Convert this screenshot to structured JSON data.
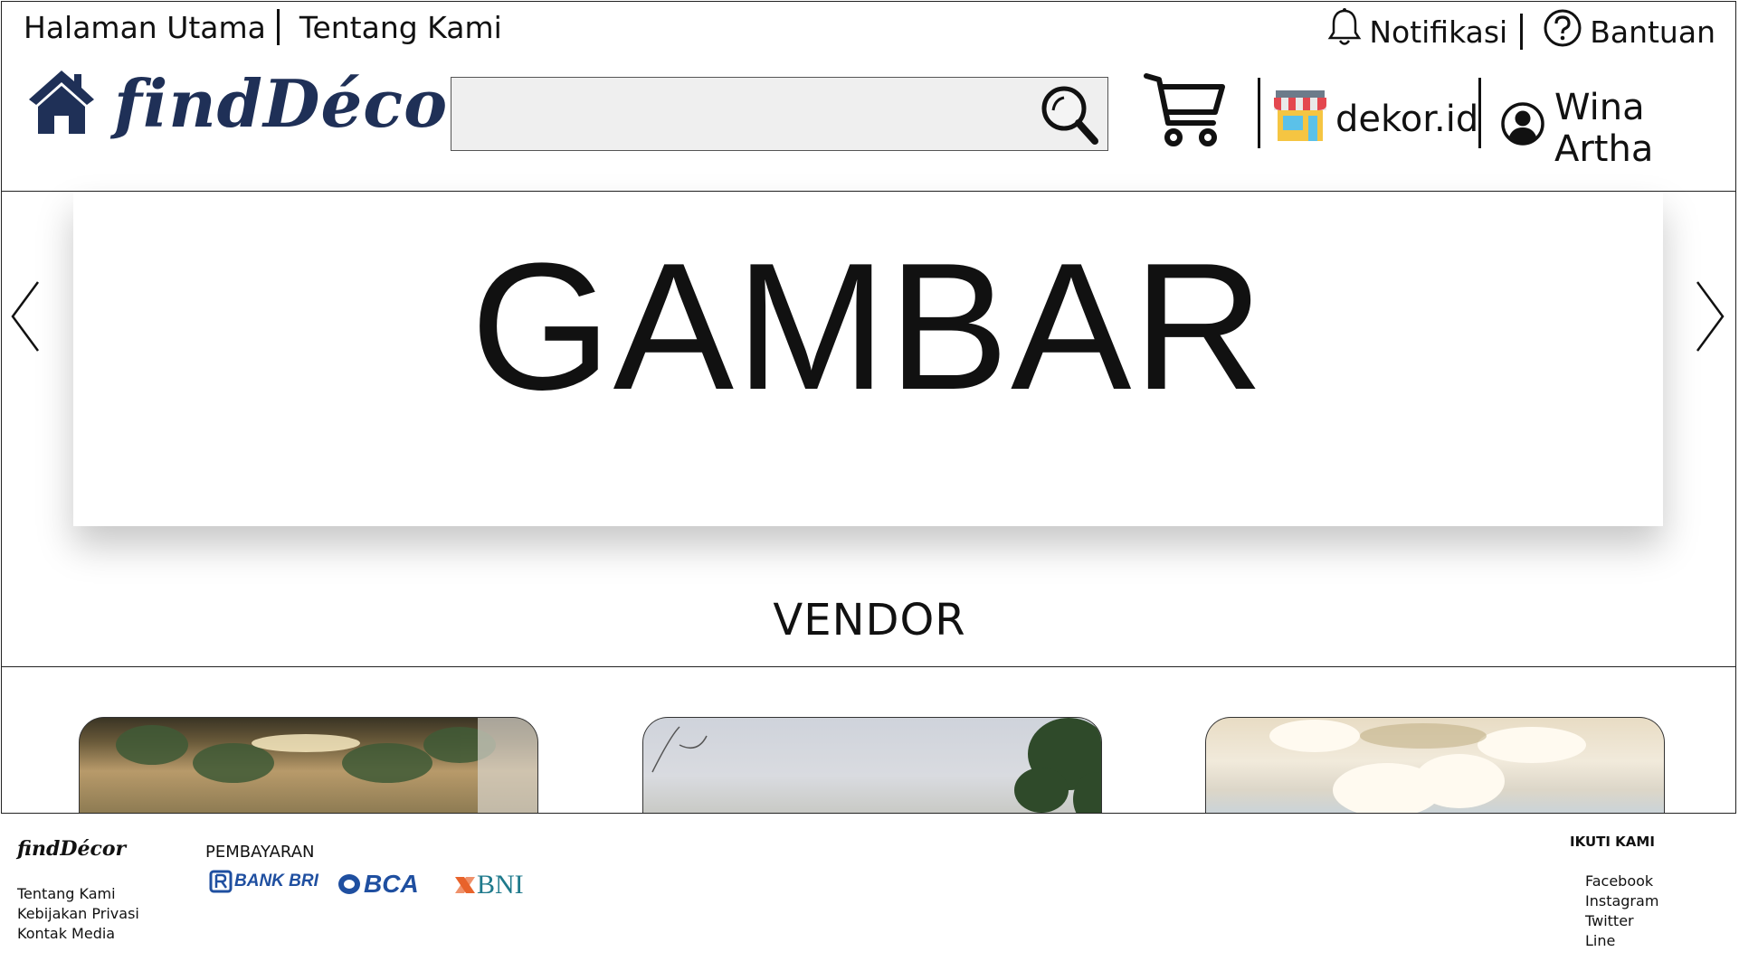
{
  "top_nav": {
    "home": "Halaman Utama",
    "about": "Tentang Kami",
    "notifications": "Notifikasi",
    "help": "Bantuan"
  },
  "header": {
    "logo_text": "findDécor",
    "search_placeholder": "",
    "store_name": "dekor.id",
    "user_name": "Wina Artha",
    "brand_color": "#1f3057"
  },
  "banner": {
    "text": "GAMBAR"
  },
  "section": {
    "title": "VENDOR"
  },
  "vendor_cards": [
    {
      "image": "wedding-backdrop-photo"
    },
    {
      "image": "outdoor-sky-photo"
    },
    {
      "image": "floral-decoration-photo"
    }
  ],
  "footer": {
    "logo_text": "findDécor",
    "links": [
      "Tentang Kami",
      "Kebijakan Privasi",
      "Kontak Media"
    ],
    "payment_title": "PEMBAYARAN",
    "payment_methods": [
      "BANK BRI",
      "BCA",
      "BNI"
    ],
    "follow_title": "IKUTI KAMI",
    "social": [
      "Facebook",
      "Instagram",
      "Twitter",
      "Line"
    ]
  }
}
